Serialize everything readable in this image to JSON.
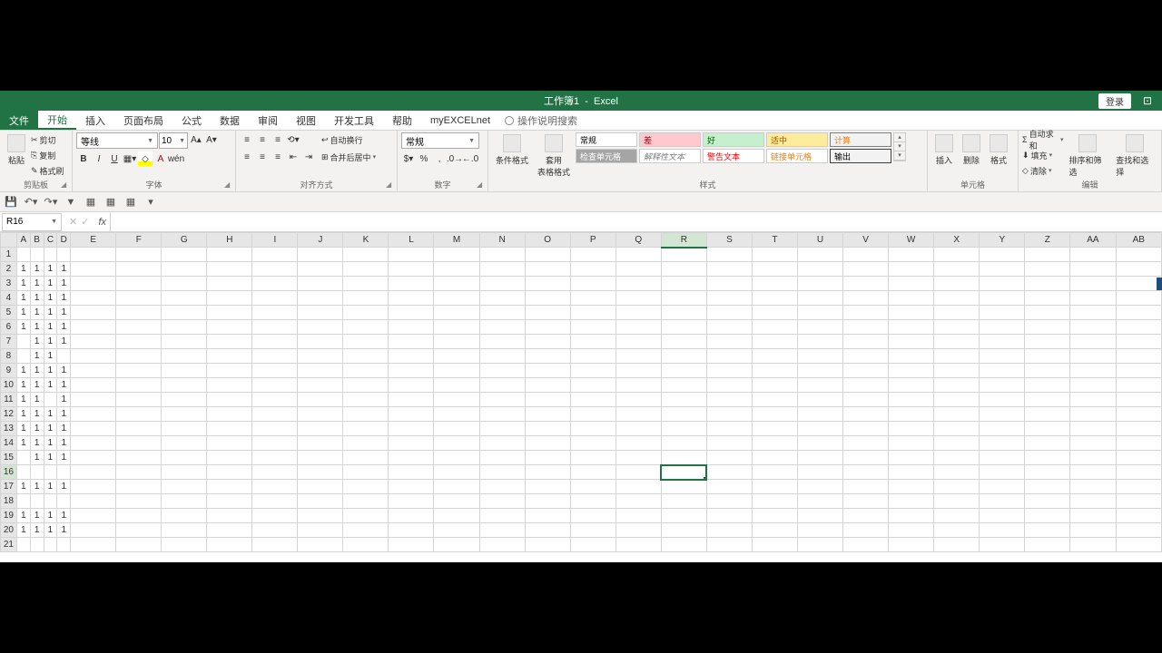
{
  "title": {
    "doc": "工作簿1",
    "app": "Excel"
  },
  "login": "登录",
  "menu": [
    "文件",
    "开始",
    "插入",
    "页面布局",
    "公式",
    "数据",
    "审阅",
    "视图",
    "开发工具",
    "帮助",
    "myEXCELnet"
  ],
  "tell_me": "操作说明搜索",
  "clipboard": {
    "label": "剪贴板",
    "paste": "粘贴",
    "cut": "剪切",
    "copy": "复制",
    "fmt": "格式刷"
  },
  "font_grp": {
    "label": "字体",
    "name": "等线",
    "size": "10",
    "bold": "B",
    "italic": "I",
    "underline": "U"
  },
  "align_grp": {
    "label": "对齐方式",
    "wrap": "自动换行",
    "merge": "合并后居中"
  },
  "number_grp": {
    "label": "数字",
    "format": "常规"
  },
  "styles_grp": {
    "label": "样式",
    "cond": "条件格式",
    "table": "套用\n表格格式",
    "cells": [
      [
        "常规",
        "差",
        "好",
        "适中",
        "计算"
      ],
      [
        "检查单元格",
        "解释性文本",
        "警告文本",
        "链接单元格",
        "输出"
      ]
    ]
  },
  "cells_grp": {
    "label": "单元格",
    "insert": "插入",
    "delete": "删除",
    "format": "格式"
  },
  "editing_grp": {
    "label": "编辑",
    "sum": "自动求和",
    "fill": "填充",
    "clear": "清除",
    "sort": "排序和筛选",
    "find": "查找和选择"
  },
  "namebox": "R16",
  "columns": [
    "A",
    "B",
    "C",
    "D",
    "E",
    "F",
    "G",
    "H",
    "I",
    "J",
    "K",
    "L",
    "M",
    "N",
    "O",
    "P",
    "Q",
    "R",
    "S",
    "T",
    "U",
    "V",
    "W",
    "X",
    "Y",
    "Z",
    "AA",
    "AB"
  ],
  "col_widths": [
    "n",
    "n",
    "n",
    "n",
    "w",
    "w",
    "w",
    "w",
    "w",
    "w",
    "w",
    "w",
    "w",
    "w",
    "w",
    "w",
    "w",
    "w",
    "w",
    "w",
    "w",
    "w",
    "w",
    "w",
    "w",
    "w",
    "w",
    "w"
  ],
  "selected_col": "R",
  "selected_row": 16,
  "rows": [
    {
      "n": 1,
      "d": [
        "",
        "",
        "",
        ""
      ]
    },
    {
      "n": 2,
      "d": [
        "1",
        "1",
        "1",
        "1"
      ]
    },
    {
      "n": 3,
      "d": [
        "1",
        "1",
        "1",
        "1"
      ]
    },
    {
      "n": 4,
      "d": [
        "1",
        "1",
        "1",
        "1"
      ]
    },
    {
      "n": 5,
      "d": [
        "1",
        "1",
        "1",
        "1"
      ]
    },
    {
      "n": 6,
      "d": [
        "1",
        "1",
        "1",
        "1"
      ]
    },
    {
      "n": 7,
      "d": [
        "",
        "1",
        "1",
        "1"
      ]
    },
    {
      "n": 8,
      "d": [
        "",
        "1",
        "1",
        ""
      ]
    },
    {
      "n": 9,
      "d": [
        "1",
        "1",
        "1",
        "1"
      ]
    },
    {
      "n": 10,
      "d": [
        "1",
        "1",
        "1",
        "1"
      ]
    },
    {
      "n": 11,
      "d": [
        "1",
        "1",
        "",
        "1"
      ]
    },
    {
      "n": 12,
      "d": [
        "1",
        "1",
        "1",
        "1"
      ]
    },
    {
      "n": 13,
      "d": [
        "1",
        "1",
        "1",
        "1"
      ]
    },
    {
      "n": 14,
      "d": [
        "1",
        "1",
        "1",
        "1"
      ]
    },
    {
      "n": 15,
      "d": [
        "",
        "1",
        "1",
        "1"
      ]
    },
    {
      "n": 16,
      "d": [
        "",
        "",
        "",
        ""
      ]
    },
    {
      "n": 17,
      "d": [
        "1",
        "1",
        "1",
        "1"
      ]
    },
    {
      "n": 18,
      "d": [
        "",
        "",
        "",
        ""
      ]
    },
    {
      "n": 19,
      "d": [
        "1",
        "1",
        "1",
        "1"
      ]
    },
    {
      "n": 20,
      "d": [
        "1",
        "1",
        "1",
        "1"
      ]
    },
    {
      "n": 21,
      "d": [
        "",
        "",
        "",
        ""
      ]
    }
  ]
}
